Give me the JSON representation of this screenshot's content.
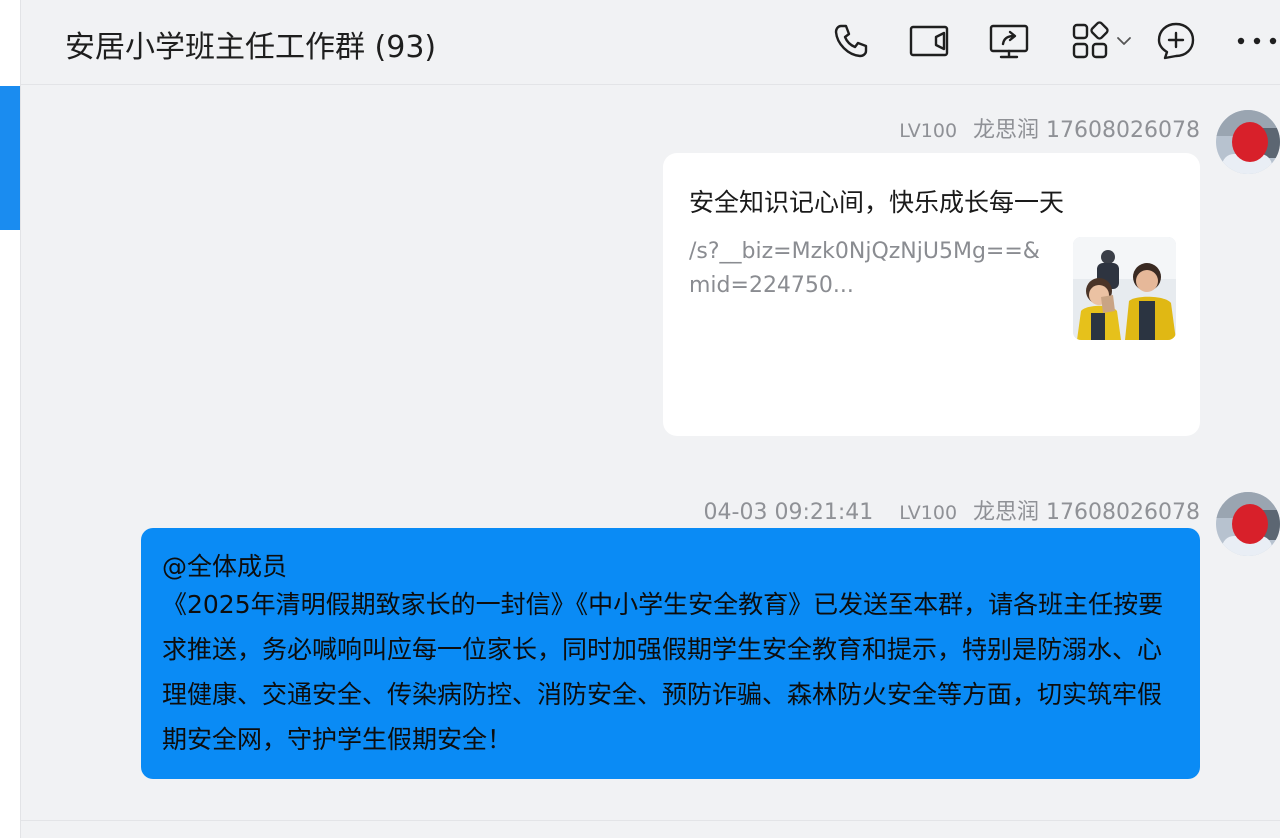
{
  "header": {
    "title": "安居小学班主任工作群 (93)",
    "icons": [
      "phone-icon",
      "video-call-icon",
      "screen-share-icon",
      "apps-grid-icon",
      "chevron-down-icon",
      "add-chat-icon",
      "more-icon"
    ]
  },
  "messages": [
    {
      "sender_level": "LV100",
      "sender_name": "龙思润 17608026078",
      "type": "link_card",
      "card": {
        "title": "安全知识记心间，快乐成长每一天",
        "url": "/s?__biz=Mzk0NjQzNjU5Mg==&mid=224750..."
      }
    },
    {
      "timestamp": "04-03 09:21:41",
      "sender_level": "LV100",
      "sender_name": "龙思润 17608026078",
      "type": "text",
      "mention": "@全体成员",
      "text": "《2025年清明假期致家长的一封信》《中小学生安全教育》已发送至本群，请各班主任按要求推送，务必喊响叫应每一位家长，同时加强假期学生安全教育和提示，特别是防溺水、心理健康、交通安全、传染病防控、消防安全、预防诈骗、森林防火安全等方面，切实筑牢假期安全网，守护学生假期安全！"
    }
  ],
  "colors": {
    "accent": "#1a8cf0",
    "self_bubble": "#0a8bf5",
    "background": "#f1f2f4",
    "meta_text": "#8f9196"
  }
}
